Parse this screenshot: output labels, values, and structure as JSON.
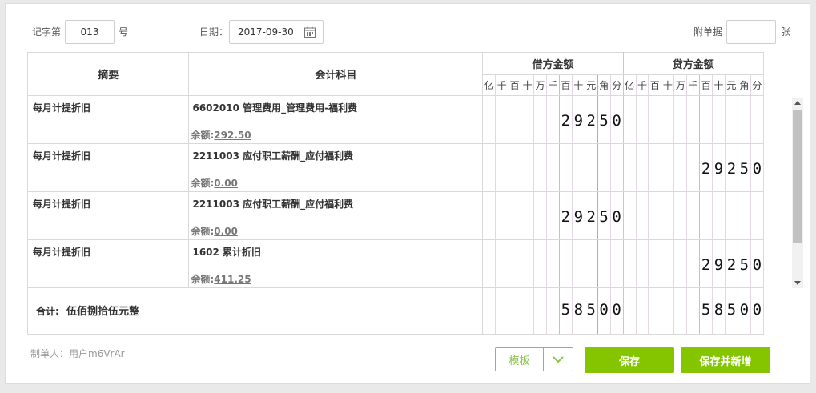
{
  "header": {
    "voucher_word_label": "记字第",
    "voucher_no": "013",
    "voucher_no_suffix": "号",
    "date_label": "日期：",
    "date_value": "2017-09-30",
    "attach_label": "附单据",
    "attach_value": "",
    "attach_suffix": "张"
  },
  "columns": {
    "summary": "摘要",
    "account": "会计科目",
    "debit": "借方金额",
    "credit": "贷方金额",
    "digits": [
      "亿",
      "千",
      "百",
      "十",
      "万",
      "千",
      "百",
      "十",
      "元",
      "角",
      "分"
    ]
  },
  "entries": [
    {
      "summary": "每月计提折旧",
      "account": "6602010 管理费用_管理费用-福利费",
      "balance_label": "余额:",
      "balance": "292.50",
      "debit": "29250",
      "credit": ""
    },
    {
      "summary": "每月计提折旧",
      "account": "2211003 应付职工薪酬_应付福利费",
      "balance_label": "余额:",
      "balance": "0.00",
      "debit": "",
      "credit": "29250"
    },
    {
      "summary": "每月计提折旧",
      "account": "2211003 应付职工薪酬_应付福利费",
      "balance_label": "余额:",
      "balance": "0.00",
      "debit": "29250",
      "credit": ""
    },
    {
      "summary": "每月计提折旧",
      "account": "1602 累计折旧",
      "balance_label": "余额:",
      "balance": "411.25",
      "debit": "",
      "credit": "29250"
    }
  ],
  "total": {
    "label": "合计:",
    "amount_words": "伍佰捌拾伍元整",
    "debit": "58500",
    "credit": "58500"
  },
  "footer": {
    "maker": "制单人：用户m6VrAr",
    "template_label": "模板",
    "save_label": "保存",
    "save_new_label": "保存并新增"
  },
  "colors": {
    "accent": "#84c500",
    "outline_green": "#8bc34a"
  }
}
